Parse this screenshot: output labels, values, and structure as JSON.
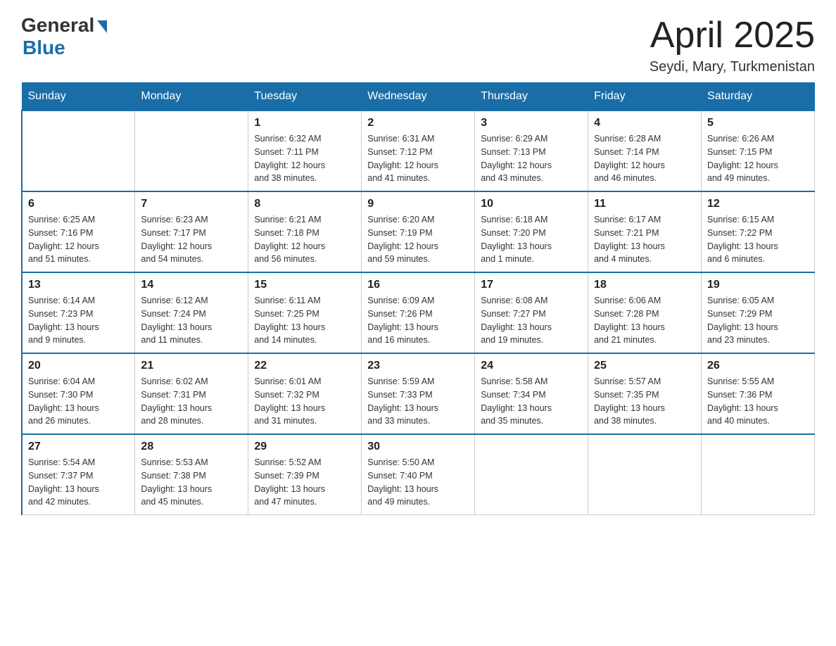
{
  "header": {
    "logo": {
      "general_text": "General",
      "blue_text": "Blue"
    },
    "title": "April 2025",
    "location": "Seydi, Mary, Turkmenistan"
  },
  "calendar": {
    "days_of_week": [
      "Sunday",
      "Monday",
      "Tuesday",
      "Wednesday",
      "Thursday",
      "Friday",
      "Saturday"
    ],
    "weeks": [
      [
        {
          "day": "",
          "info": ""
        },
        {
          "day": "",
          "info": ""
        },
        {
          "day": "1",
          "info": "Sunrise: 6:32 AM\nSunset: 7:11 PM\nDaylight: 12 hours\nand 38 minutes."
        },
        {
          "day": "2",
          "info": "Sunrise: 6:31 AM\nSunset: 7:12 PM\nDaylight: 12 hours\nand 41 minutes."
        },
        {
          "day": "3",
          "info": "Sunrise: 6:29 AM\nSunset: 7:13 PM\nDaylight: 12 hours\nand 43 minutes."
        },
        {
          "day": "4",
          "info": "Sunrise: 6:28 AM\nSunset: 7:14 PM\nDaylight: 12 hours\nand 46 minutes."
        },
        {
          "day": "5",
          "info": "Sunrise: 6:26 AM\nSunset: 7:15 PM\nDaylight: 12 hours\nand 49 minutes."
        }
      ],
      [
        {
          "day": "6",
          "info": "Sunrise: 6:25 AM\nSunset: 7:16 PM\nDaylight: 12 hours\nand 51 minutes."
        },
        {
          "day": "7",
          "info": "Sunrise: 6:23 AM\nSunset: 7:17 PM\nDaylight: 12 hours\nand 54 minutes."
        },
        {
          "day": "8",
          "info": "Sunrise: 6:21 AM\nSunset: 7:18 PM\nDaylight: 12 hours\nand 56 minutes."
        },
        {
          "day": "9",
          "info": "Sunrise: 6:20 AM\nSunset: 7:19 PM\nDaylight: 12 hours\nand 59 minutes."
        },
        {
          "day": "10",
          "info": "Sunrise: 6:18 AM\nSunset: 7:20 PM\nDaylight: 13 hours\nand 1 minute."
        },
        {
          "day": "11",
          "info": "Sunrise: 6:17 AM\nSunset: 7:21 PM\nDaylight: 13 hours\nand 4 minutes."
        },
        {
          "day": "12",
          "info": "Sunrise: 6:15 AM\nSunset: 7:22 PM\nDaylight: 13 hours\nand 6 minutes."
        }
      ],
      [
        {
          "day": "13",
          "info": "Sunrise: 6:14 AM\nSunset: 7:23 PM\nDaylight: 13 hours\nand 9 minutes."
        },
        {
          "day": "14",
          "info": "Sunrise: 6:12 AM\nSunset: 7:24 PM\nDaylight: 13 hours\nand 11 minutes."
        },
        {
          "day": "15",
          "info": "Sunrise: 6:11 AM\nSunset: 7:25 PM\nDaylight: 13 hours\nand 14 minutes."
        },
        {
          "day": "16",
          "info": "Sunrise: 6:09 AM\nSunset: 7:26 PM\nDaylight: 13 hours\nand 16 minutes."
        },
        {
          "day": "17",
          "info": "Sunrise: 6:08 AM\nSunset: 7:27 PM\nDaylight: 13 hours\nand 19 minutes."
        },
        {
          "day": "18",
          "info": "Sunrise: 6:06 AM\nSunset: 7:28 PM\nDaylight: 13 hours\nand 21 minutes."
        },
        {
          "day": "19",
          "info": "Sunrise: 6:05 AM\nSunset: 7:29 PM\nDaylight: 13 hours\nand 23 minutes."
        }
      ],
      [
        {
          "day": "20",
          "info": "Sunrise: 6:04 AM\nSunset: 7:30 PM\nDaylight: 13 hours\nand 26 minutes."
        },
        {
          "day": "21",
          "info": "Sunrise: 6:02 AM\nSunset: 7:31 PM\nDaylight: 13 hours\nand 28 minutes."
        },
        {
          "day": "22",
          "info": "Sunrise: 6:01 AM\nSunset: 7:32 PM\nDaylight: 13 hours\nand 31 minutes."
        },
        {
          "day": "23",
          "info": "Sunrise: 5:59 AM\nSunset: 7:33 PM\nDaylight: 13 hours\nand 33 minutes."
        },
        {
          "day": "24",
          "info": "Sunrise: 5:58 AM\nSunset: 7:34 PM\nDaylight: 13 hours\nand 35 minutes."
        },
        {
          "day": "25",
          "info": "Sunrise: 5:57 AM\nSunset: 7:35 PM\nDaylight: 13 hours\nand 38 minutes."
        },
        {
          "day": "26",
          "info": "Sunrise: 5:55 AM\nSunset: 7:36 PM\nDaylight: 13 hours\nand 40 minutes."
        }
      ],
      [
        {
          "day": "27",
          "info": "Sunrise: 5:54 AM\nSunset: 7:37 PM\nDaylight: 13 hours\nand 42 minutes."
        },
        {
          "day": "28",
          "info": "Sunrise: 5:53 AM\nSunset: 7:38 PM\nDaylight: 13 hours\nand 45 minutes."
        },
        {
          "day": "29",
          "info": "Sunrise: 5:52 AM\nSunset: 7:39 PM\nDaylight: 13 hours\nand 47 minutes."
        },
        {
          "day": "30",
          "info": "Sunrise: 5:50 AM\nSunset: 7:40 PM\nDaylight: 13 hours\nand 49 minutes."
        },
        {
          "day": "",
          "info": ""
        },
        {
          "day": "",
          "info": ""
        },
        {
          "day": "",
          "info": ""
        }
      ]
    ]
  }
}
